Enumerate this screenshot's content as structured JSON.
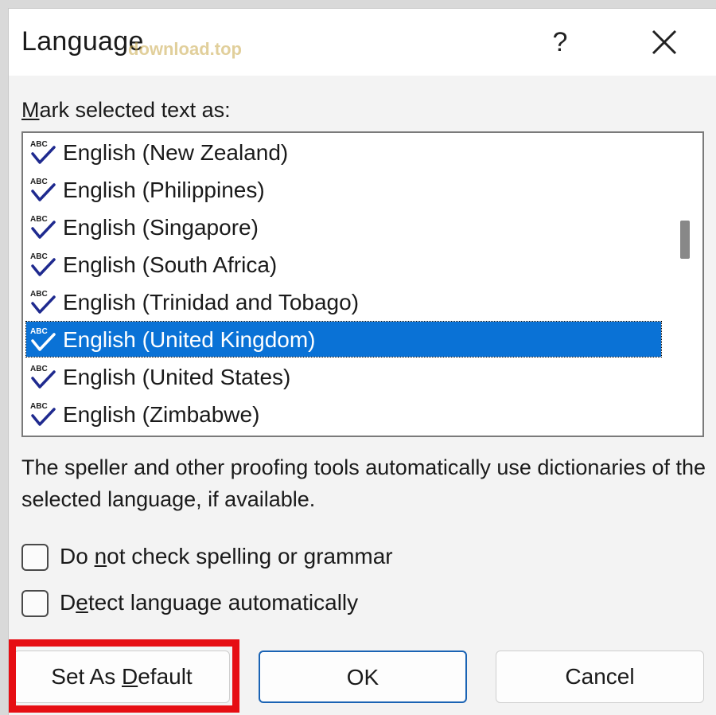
{
  "dialog": {
    "title": "Language",
    "watermark": "download.top",
    "help_label": "?",
    "close_icon": "close-icon"
  },
  "mark_label": {
    "accel": "M",
    "rest": "ark selected text as:"
  },
  "languages": [
    {
      "label": "English (New Zealand)",
      "selected": false
    },
    {
      "label": "English (Philippines)",
      "selected": false
    },
    {
      "label": "English (Singapore)",
      "selected": false
    },
    {
      "label": "English (South Africa)",
      "selected": false
    },
    {
      "label": "English (Trinidad and Tobago)",
      "selected": false
    },
    {
      "label": "English (United Kingdom)",
      "selected": true
    },
    {
      "label": "English (United States)",
      "selected": false
    },
    {
      "label": "English (Zimbabwe)",
      "selected": false
    }
  ],
  "info_text": "The speller and other proofing tools automatically use dictionaries of the selected language, if available.",
  "checkboxes": {
    "no_check": {
      "pre": "Do ",
      "accel": "n",
      "post": "ot check spelling or grammar",
      "checked": false
    },
    "detect": {
      "pre": "D",
      "accel": "e",
      "post": "tect language automatically",
      "checked": false
    }
  },
  "buttons": {
    "set_default": {
      "pre": "Set As ",
      "accel": "D",
      "post": "efault"
    },
    "ok": "OK",
    "cancel": "Cancel"
  },
  "colors": {
    "selection": "#0a72d6",
    "highlight": "#e60e13",
    "ok_border": "#1a63b4",
    "spell_icon": "#1f2a8f"
  }
}
